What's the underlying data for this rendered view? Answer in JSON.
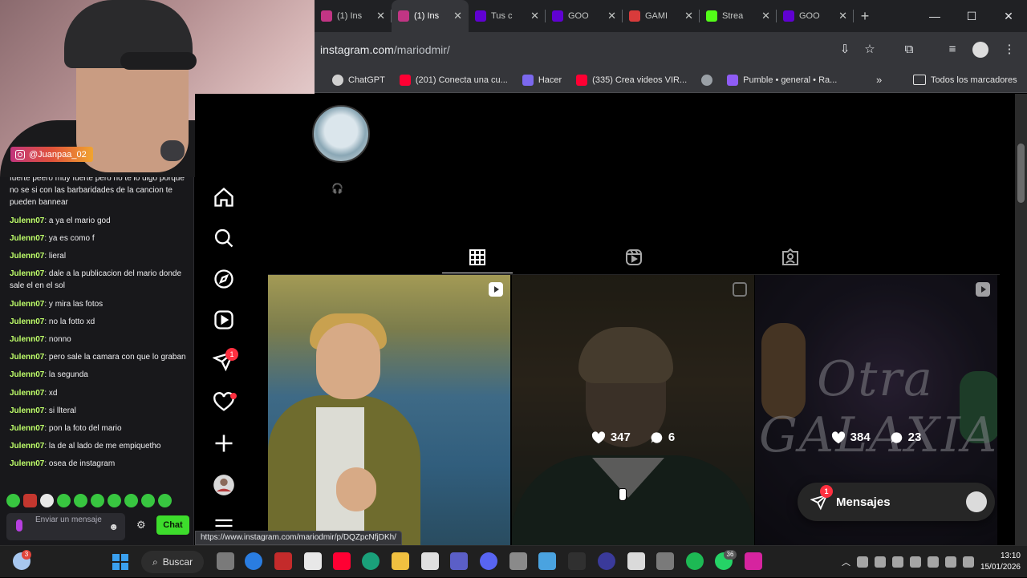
{
  "webcam": {
    "handle": "@Juanpaa_02"
  },
  "chat": {
    "messages": [
      {
        "user": "",
        "text": "fuerte peero muy fuerte pero no te lo digo porque no se si con las barbaridades de la cancion te pueden bannear"
      },
      {
        "user": "Julenn07",
        "text": "a ya el mario god"
      },
      {
        "user": "Julenn07",
        "text": "ya es como f"
      },
      {
        "user": "Julenn07",
        "text": "lieral"
      },
      {
        "user": "Julenn07",
        "text": "dale a la publicacion del mario donde sale el en el sol"
      },
      {
        "user": "Julenn07",
        "text": "y mira las fotos"
      },
      {
        "user": "Julenn07",
        "text": "no la fotto xd"
      },
      {
        "user": "Julenn07",
        "text": "nonno"
      },
      {
        "user": "Julenn07",
        "text": "pero sale la camara con que lo graban"
      },
      {
        "user": "Julenn07",
        "text": "la segunda"
      },
      {
        "user": "Julenn07",
        "text": "xd"
      },
      {
        "user": "Julenn07",
        "text": "si llteral"
      },
      {
        "user": "Julenn07",
        "text": "pon la foto del mario"
      },
      {
        "user": "Julenn07",
        "text": "la de al lado de me empiquetho"
      },
      {
        "user": "Julenn07",
        "text": "osea de instagram"
      }
    ],
    "input_placeholder": "Enviar un mensaje",
    "send_label": "Chat"
  },
  "browser": {
    "tabs": [
      {
        "title": "(1) Ins",
        "favicon": "instagram-icon",
        "color": "#c13584",
        "active": false
      },
      {
        "title": "(1) Ins",
        "favicon": "instagram-icon",
        "color": "#c13584",
        "active": true
      },
      {
        "title": "Tus c",
        "favicon": "yahoo-icon",
        "color": "#6001d2",
        "active": false
      },
      {
        "title": "GOO",
        "favicon": "yahoo-icon",
        "color": "#6001d2",
        "active": false
      },
      {
        "title": "GAMI",
        "favicon": "g-icon",
        "color": "#d93b3b",
        "active": false
      },
      {
        "title": "Strea",
        "favicon": "kick-icon",
        "color": "#53fc18",
        "active": false
      },
      {
        "title": "GOO",
        "favicon": "yahoo-icon",
        "color": "#6001d2",
        "active": false
      }
    ],
    "url_host": "instagram.com",
    "url_path": "/mariodmir/",
    "bookmarks": [
      {
        "label": "ChatGPT",
        "icon": "chatgpt-icon",
        "color": "#d0d0d0"
      },
      {
        "label": "(201) Conecta una cu...",
        "icon": "youtube-icon",
        "color": "#ff0033"
      },
      {
        "label": "Hacer",
        "icon": "clickup-icon",
        "color": "#7b68ee"
      },
      {
        "label": "(335) Crea videos VIR...",
        "icon": "youtube-icon",
        "color": "#ff0033"
      },
      {
        "label": "",
        "icon": "globe-icon",
        "color": "#9aa0a6"
      },
      {
        "label": "Pumble • general • Ra...",
        "icon": "pumble-icon",
        "color": "#8f5cf5"
      }
    ],
    "all_bookmarks_label": "Todos los marcadores",
    "status_url": "https://www.instagram.com/mariodmir/p/DQZpcNfjDKh/"
  },
  "instagram": {
    "nav_notifications": "1",
    "posts": [
      {
        "type": "reel",
        "likes": "",
        "comments": ""
      },
      {
        "type": "carousel",
        "likes": "347",
        "comments": "6"
      },
      {
        "type": "reel",
        "likes": "384",
        "comments": "23"
      }
    ],
    "messages_label": "Mensajes",
    "messages_badge": "1"
  },
  "taskbar": {
    "search_label": "Buscar",
    "weather_badge": "3",
    "whatsapp_badge": "36",
    "time": "13:10",
    "date": "15/01/2026"
  }
}
